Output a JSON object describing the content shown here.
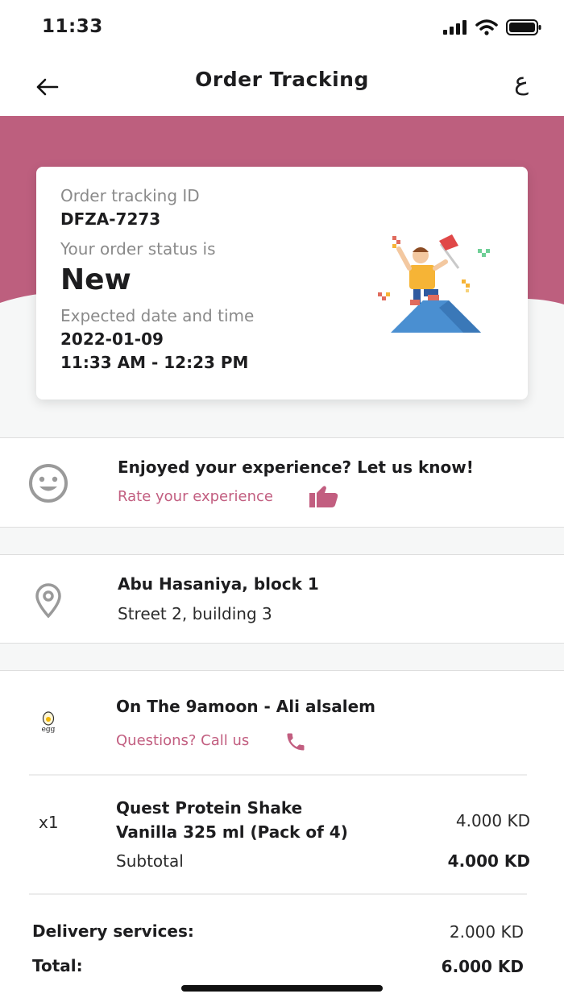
{
  "status_bar": {
    "time": "11:33"
  },
  "nav": {
    "title": "Order Tracking",
    "lang_label": "ع"
  },
  "order": {
    "tracking_label": "Order tracking ID",
    "tracking_id": "DFZA-7273",
    "status_label": "Your order status is",
    "status": "New",
    "expected_label": "Expected date and time",
    "expected_date": "2022-01-09",
    "expected_time": "11:33 AM - 12:23 PM"
  },
  "feedback": {
    "title": "Enjoyed your experience? Let us know!",
    "link": "Rate your experience"
  },
  "address": {
    "line1": "Abu Hasaniya, block 1",
    "line2": "Street 2, building 3"
  },
  "store": {
    "name": "On The 9amoon - Ali alsalem",
    "logo_text": "egg",
    "call_link": "Questions? Call us"
  },
  "item": {
    "qty": "x1",
    "name_line1": "Quest Protein Shake",
    "name_line2": "Vanilla 325 ml (Pack of 4)",
    "price": "4.000 KD",
    "subtotal_label": "Subtotal",
    "subtotal_value": "4.000 KD"
  },
  "totals": {
    "delivery_label": "Delivery services:",
    "delivery_value": "2.000 KD",
    "total_label": "Total:",
    "total_value": "6.000 KD"
  },
  "colors": {
    "accent": "#c25e80",
    "hero": "#bd5f7e"
  }
}
